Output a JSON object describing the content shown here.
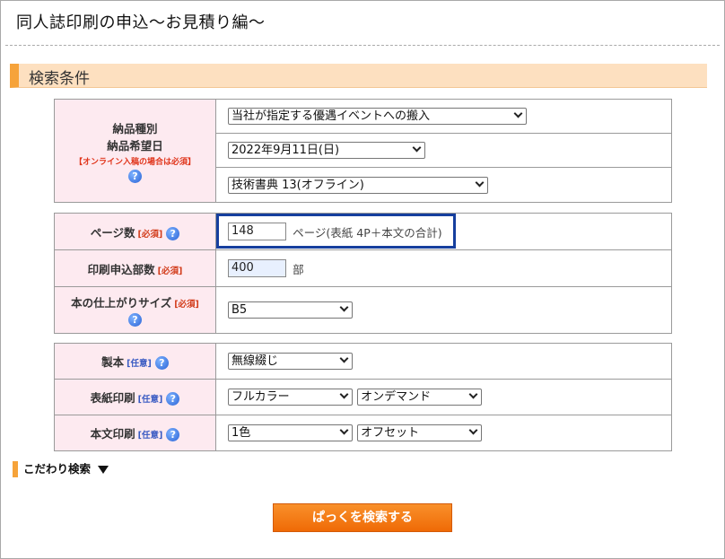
{
  "page": {
    "title": "同人誌印刷の申込～お見積り編～"
  },
  "section": {
    "title": "検索条件"
  },
  "delivery": {
    "label1": "納品種別",
    "label2": "納品希望日",
    "note": "【オンライン入稿の場合は必須】",
    "type_value": "当社が指定する優遇イベントへの搬入",
    "date_value": "2022年9月11日(日)",
    "event_value": "技術書典 13(オフライン)"
  },
  "pages": {
    "label": "ページ数",
    "req": "[必須]",
    "value": "148",
    "unit": "ページ(表紙 4P＋本文の合計)"
  },
  "copies": {
    "label": "印刷申込部数",
    "req": "[必須]",
    "value": "400",
    "unit": "部"
  },
  "size": {
    "label": "本の仕上がりサイズ",
    "req": "[必須]",
    "value": "B5"
  },
  "binding": {
    "label": "製本",
    "opt": "[任意]",
    "value": "無線綴じ"
  },
  "cover": {
    "label": "表紙印刷",
    "opt": "[任意]",
    "color_value": "フルカラー",
    "method_value": "オンデマンド"
  },
  "body_print": {
    "label": "本文印刷",
    "opt": "[任意]",
    "color_value": "1色",
    "method_value": "オフセット"
  },
  "kodawari": {
    "label": "こだわり検索"
  },
  "search_button": {
    "label": "ぱっくを検索する"
  },
  "help_icon": {
    "glyph": "?"
  },
  "colors": {
    "accent": "#f6a33a",
    "label_bg": "#fdeaf0",
    "highlight": "#163f9e",
    "button": "#f57c10"
  }
}
